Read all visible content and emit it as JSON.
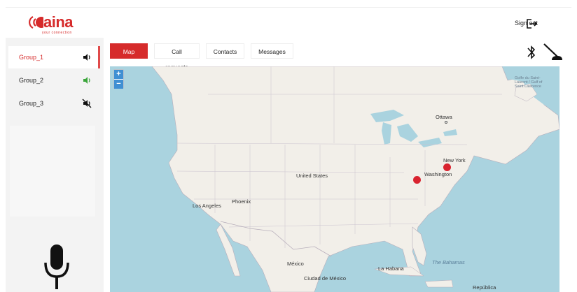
{
  "brand": {
    "name": "aina",
    "tagline": "your connection"
  },
  "header": {
    "signout_label": "Sign out"
  },
  "sidebar": {
    "groups": [
      {
        "label": "Group_1",
        "audio": "speaker-on",
        "active": true
      },
      {
        "label": "Group_2",
        "audio": "speaker-on-green",
        "active": false
      },
      {
        "label": "Group_3",
        "audio": "speaker-muted",
        "active": false
      }
    ]
  },
  "tabs": [
    {
      "label": "Map",
      "active": true
    },
    {
      "label": "Call requests",
      "active": false
    },
    {
      "label": "Contacts",
      "active": false
    },
    {
      "label": "Messages",
      "active": false
    }
  ],
  "map": {
    "zoom_in": "+",
    "zoom_out": "−",
    "labels": {
      "united_states": "United States",
      "ottawa": "Ottawa",
      "new_york": "New York",
      "washington": "Washington",
      "phoenix": "Phoenix",
      "los_angeles": "Los Angeles",
      "mexico": "México",
      "ciudad_de_mexico": "Ciudad de México",
      "la_habana": "La Habana",
      "the_bahamas": "The Bahamas",
      "republica": "República",
      "gulf": "Golfe du Saint-Laurent / Gulf of Saint Lawrence"
    },
    "marker_color": "#d9232f"
  },
  "colors": {
    "accent": "#d62b2b",
    "water": "#aad3df",
    "land": "#f2efe9"
  }
}
